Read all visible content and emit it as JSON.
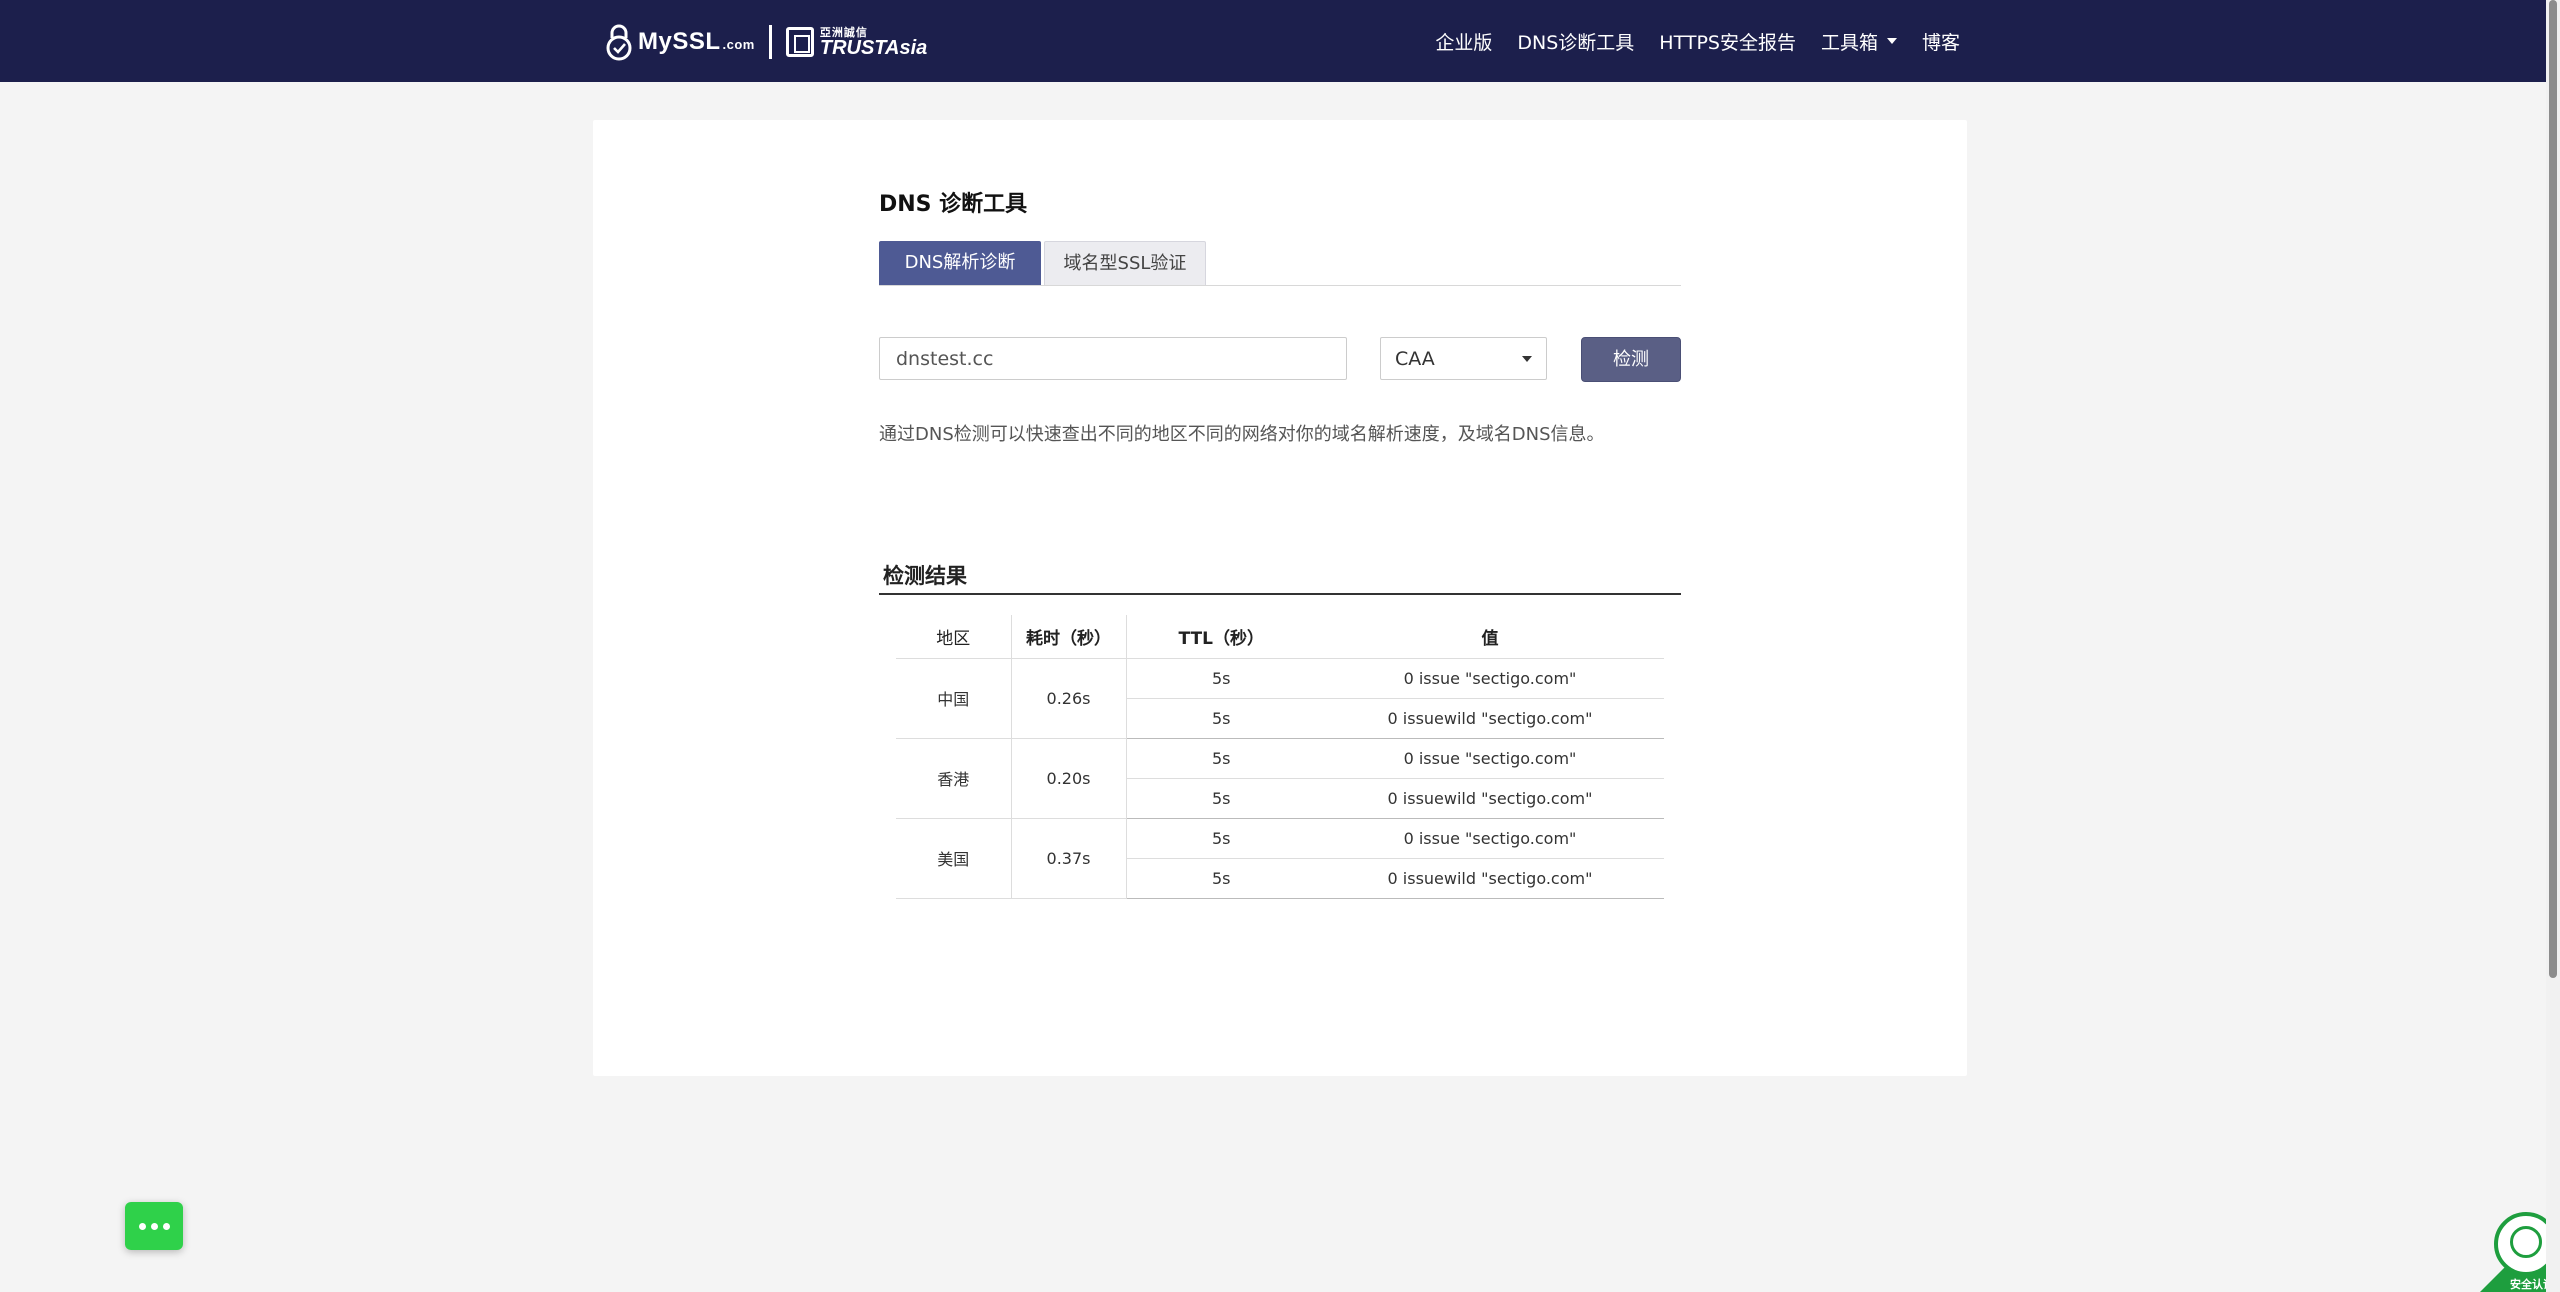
{
  "header": {
    "logo": {
      "brand": "MySSL",
      "brand_suffix": ".com",
      "partner_cn": "亞洲誠信",
      "partner_en": "TRUSTAsia"
    },
    "nav": [
      {
        "label": "企业版"
      },
      {
        "label": "DNS诊断工具"
      },
      {
        "label": "HTTPS安全报告"
      },
      {
        "label": "工具箱",
        "has_dropdown": true
      },
      {
        "label": "博客"
      }
    ]
  },
  "main": {
    "title": "DNS 诊断工具",
    "tabs": [
      {
        "label": "DNS解析诊断",
        "active": true
      },
      {
        "label": "域名型SSL验证",
        "active": false
      }
    ],
    "domain_input": {
      "value": "dnstest.cc"
    },
    "record_type": {
      "selected": "CAA"
    },
    "check_button": "检测",
    "description": "通过DNS检测可以快速查出不同的地区不同的网络对你的域名解析速度，及域名DNS信息。",
    "results": {
      "title": "检测结果",
      "columns": [
        "地区",
        "耗时（秒）",
        "TTL（秒）",
        "值"
      ],
      "groups": [
        {
          "region": "中国",
          "time": "0.26s",
          "records": [
            {
              "ttl": "5s",
              "value": "0 issue \"sectigo.com\""
            },
            {
              "ttl": "5s",
              "value": "0 issuewild \"sectigo.com\""
            }
          ]
        },
        {
          "region": "香港",
          "time": "0.20s",
          "records": [
            {
              "ttl": "5s",
              "value": "0 issue \"sectigo.com\""
            },
            {
              "ttl": "5s",
              "value": "0 issuewild \"sectigo.com\""
            }
          ]
        },
        {
          "region": "美国",
          "time": "0.37s",
          "records": [
            {
              "ttl": "5s",
              "value": "0 issue \"sectigo.com\""
            },
            {
              "ttl": "5s",
              "value": "0 issuewild \"sectigo.com\""
            }
          ]
        }
      ]
    }
  },
  "badge": {
    "label": "安全认证"
  },
  "colors": {
    "header_bg": "#1c1f4c",
    "tab_active": "#4e5a94",
    "button": "#5a5f85",
    "chat": "#2fd14a",
    "badge": "#1e9e3e"
  }
}
